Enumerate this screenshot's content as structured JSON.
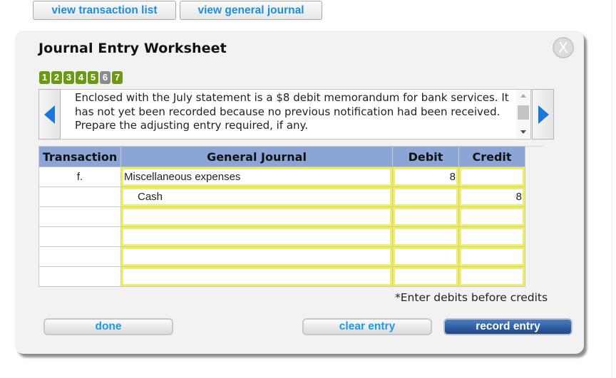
{
  "top_buttons": {
    "view_transaction_list": "view transaction list",
    "view_general_journal": "view general journal"
  },
  "modal": {
    "title": "Journal Entry Worksheet",
    "close_icon": "close-icon",
    "close_glyph": "X",
    "steps": [
      {
        "label": "1",
        "state": "default"
      },
      {
        "label": "2",
        "state": "default"
      },
      {
        "label": "3",
        "state": "default"
      },
      {
        "label": "4",
        "state": "default"
      },
      {
        "label": "5",
        "state": "default"
      },
      {
        "label": "6",
        "state": "active"
      },
      {
        "label": "7",
        "state": "default"
      }
    ],
    "prompt": "Enclosed with the July statement is a $8 debit memorandum for bank services. It has not yet been recorded because no previous notification had been received. Prepare the adjusting entry required, if any.",
    "prev_icon": "triangle-left-icon",
    "next_icon": "triangle-right-icon"
  },
  "table": {
    "headers": [
      "Transaction",
      "General Journal",
      "Debit",
      "Credit"
    ],
    "rows": [
      {
        "transaction": "f.",
        "account": "Miscellaneous expenses",
        "debit": "8",
        "credit": ""
      },
      {
        "transaction": "",
        "account": "Cash",
        "debit": "",
        "credit": "8"
      },
      {
        "transaction": "",
        "account": "",
        "debit": "",
        "credit": ""
      },
      {
        "transaction": "",
        "account": "",
        "debit": "",
        "credit": ""
      },
      {
        "transaction": "",
        "account": "",
        "debit": "",
        "credit": ""
      },
      {
        "transaction": "",
        "account": "",
        "debit": "",
        "credit": ""
      }
    ]
  },
  "hint": "*Enter debits before credits",
  "footer": {
    "done": "done",
    "clear_entry": "clear entry",
    "record_entry": "record entry"
  },
  "colors": {
    "step_default": "#6a9a14",
    "step_active": "#8c8c8c",
    "table_header": "#8ba6d6",
    "input_border": "#f2f243",
    "link_blue": "#1a8fe0",
    "record_button": "#2f5ea4"
  }
}
